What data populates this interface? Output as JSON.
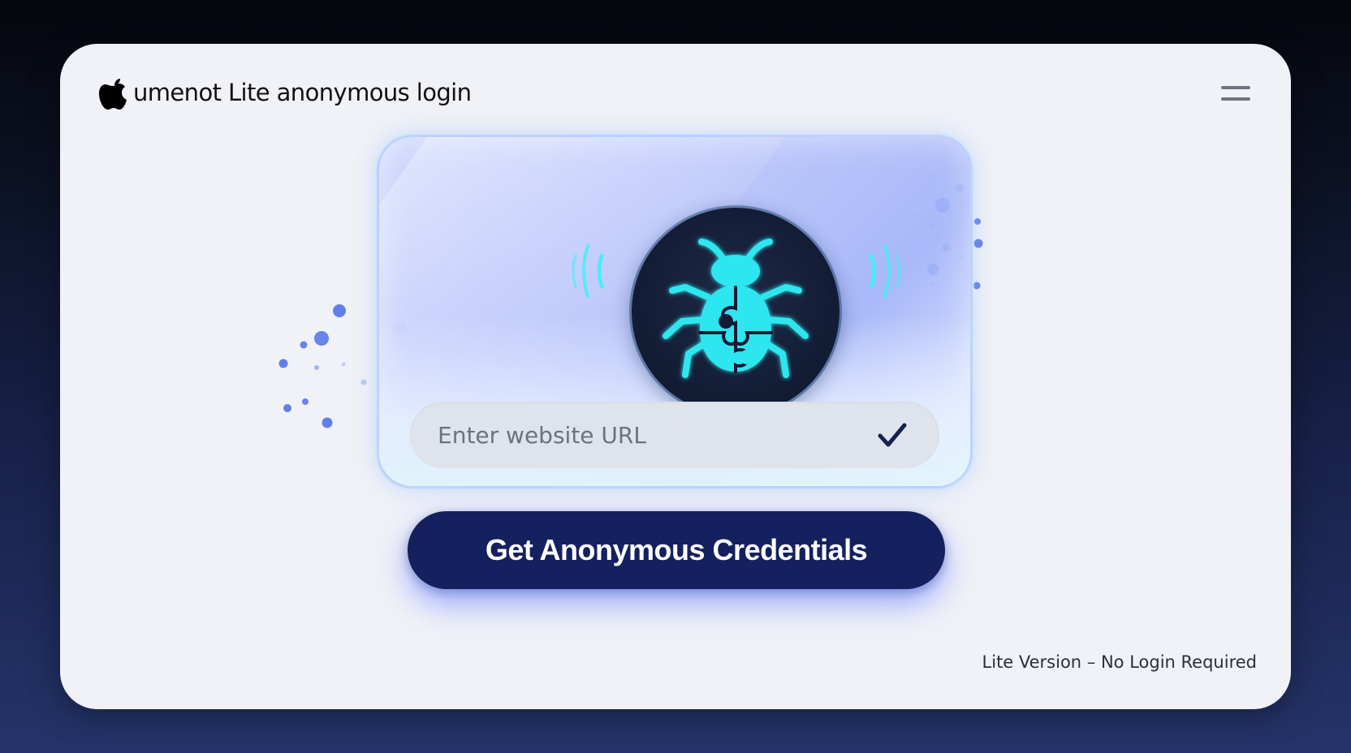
{
  "app": {
    "title": "umenot Lite anonymous login",
    "logo_icon": "apple-logo-icon",
    "menu_icon": "hamburger-menu-icon"
  },
  "hero": {
    "badge_icon": "bug-puzzle-icon",
    "signal_icon": "signal-waves-icon"
  },
  "form": {
    "url_placeholder": "Enter website URL",
    "url_value": "",
    "confirm_icon": "checkmark-icon",
    "submit_label": "Get Anonymous Credentials"
  },
  "footer": {
    "note": "Lite Version – No Login Required"
  },
  "colors": {
    "primary": "#15215e",
    "bug_cyan": "#2ee6f0",
    "dot_blue": "#5a78e8",
    "card_bg": "#f1f2f7"
  }
}
